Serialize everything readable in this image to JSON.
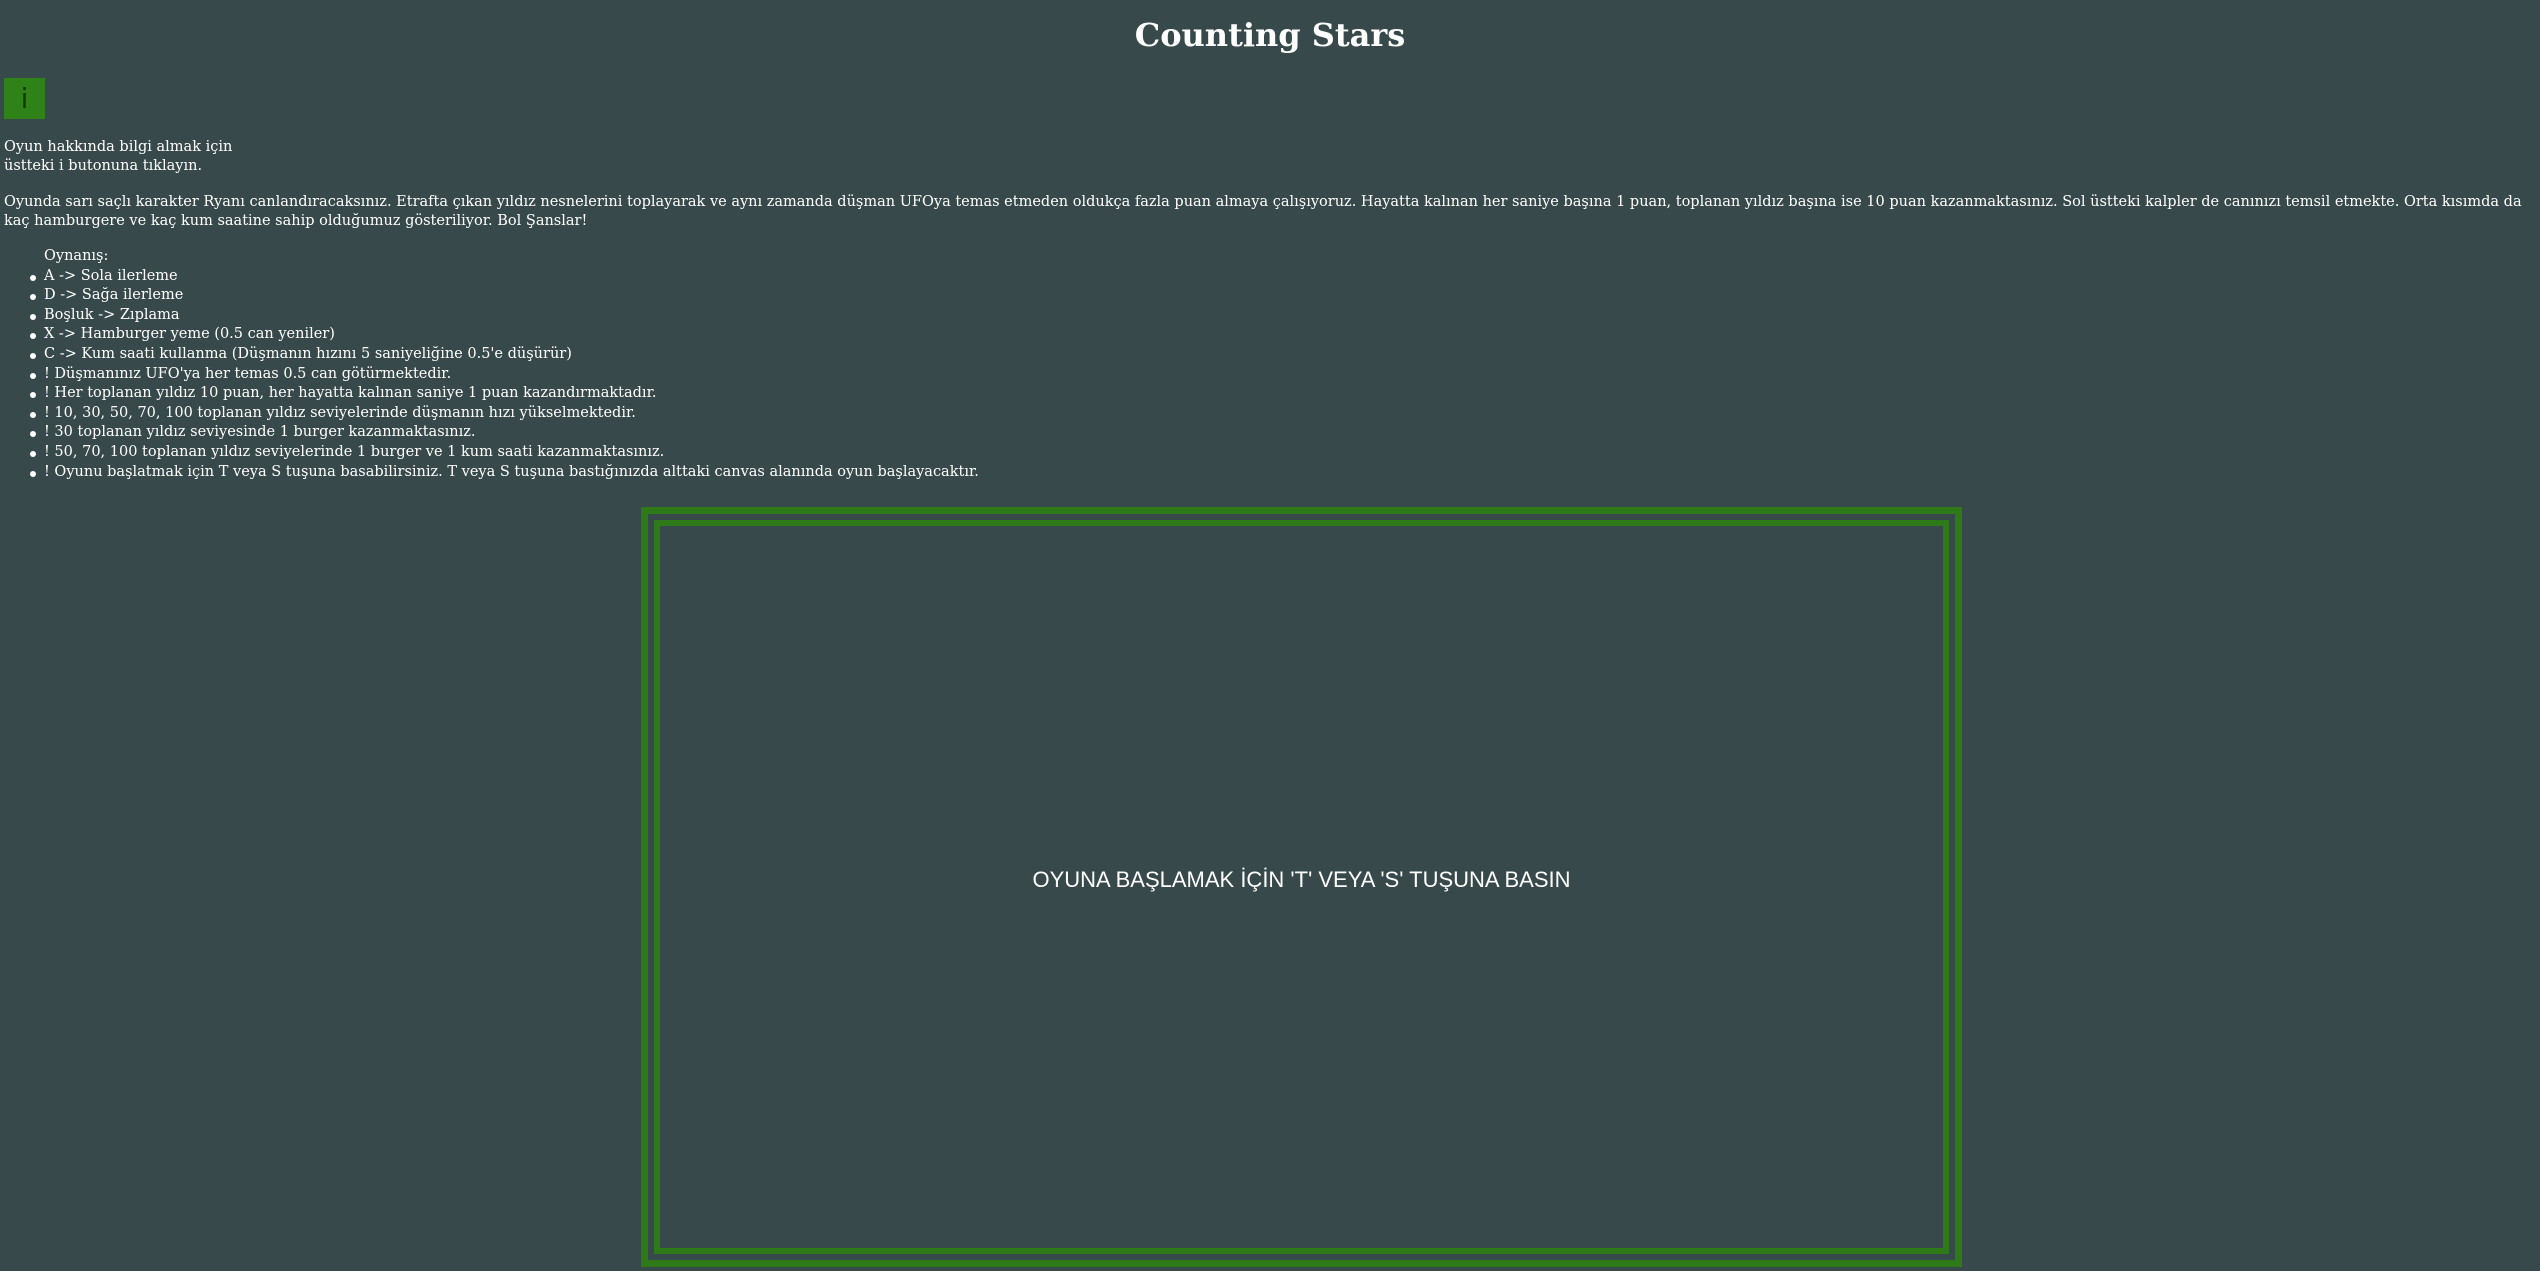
{
  "header": {
    "title": "Counting Stars"
  },
  "info": {
    "button_label": "i",
    "hint_line1": "Oyun hakkında bilgi almak için",
    "hint_line2": "üstteki i butonuna tıklayın."
  },
  "intro": {
    "text": "Oyunda sarı saçlı karakter Ryanı canlandıracaksınız. Etrafta çıkan yıldız nesnelerini toplayarak ve aynı zamanda düşman UFOya temas etmeden oldukça fazla puan almaya çalışıyoruz. Hayatta kalınan her saniye başına 1 puan, toplanan yıldız başına ise 10 puan kazanmaktasınız. Sol üstteki kalpler de canınızı temsil etmekte. Orta kısımda da kaç hamburgere ve kaç kum saatine sahip olduğumuz gösteriliyor. Bol Şanslar!"
  },
  "rules": {
    "heading": "Oynanış:",
    "items": [
      "A -> Sola ilerleme",
      "D -> Sağa ilerleme",
      "Boşluk -> Zıplama",
      "X -> Hamburger yeme (0.5 can yeniler)",
      "C -> Kum saati kullanma (Düşmanın hızını 5 saniyeliğine 0.5'e düşürür)",
      "! Düşmanınız UFO'ya her temas 0.5 can götürmektedir.",
      "! Her toplanan yıldız 10 puan, her hayatta kalınan saniye 1 puan kazandırmaktadır.",
      "! 10, 30, 50, 70, 100 toplanan yıldız seviyelerinde düşmanın hızı yükselmektedir.",
      "! 30 toplanan yıldız seviyesinde 1 burger kazanmaktasınız.",
      "! 50, 70, 100 toplanan yıldız seviyelerinde 1 burger ve 1 kum saati kazanmaktasınız.",
      "! Oyunu başlatmak için T veya S tuşuna basabilirsiniz. T veya S tuşuna bastığınızda alttaki canvas alanında oyun başlayacaktır."
    ]
  },
  "game": {
    "start_prompt": "OYUNA BAŞLAMAK İÇİN 'T' VEYA 'S' TUŞUNA BASIN"
  },
  "colors": {
    "background": "#37494a",
    "accent_green": "#2f7a18",
    "button_green": "#2f8217",
    "text": "#ffffff"
  }
}
